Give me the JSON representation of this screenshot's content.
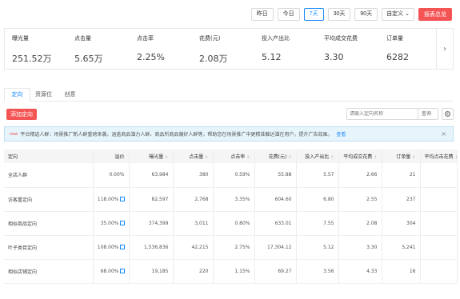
{
  "date_bar": {
    "buttons": [
      "昨日",
      "今日",
      "7天",
      "30天",
      "90天"
    ],
    "active": "7天",
    "custom_label": "自定义",
    "report_label": "报表总览"
  },
  "metrics": [
    {
      "label": "曝光量",
      "value": "251.52万"
    },
    {
      "label": "点击量",
      "value": "5.65万"
    },
    {
      "label": "点击率",
      "value": "2.25%"
    },
    {
      "label": "花费(元)",
      "value": "2.08万"
    },
    {
      "label": "投入产出比",
      "value": "5.12"
    },
    {
      "label": "平均成交花费",
      "value": "3.30"
    },
    {
      "label": "订单量",
      "value": "6282"
    }
  ],
  "tabs": [
    "定向",
    "资源位",
    "创意"
  ],
  "toolbar": {
    "add_label": "添加定向",
    "search_placeholder": "请输入定向名称",
    "search_button": "查询"
  },
  "notice": {
    "badge": "new",
    "text": "平台精选人群：场景推广新人群重磅来袭，涵盖商品潜力人群、商品所商品偏好人群等，帮助您在场景推广中更精准触达潜在用户，提升广告效果。",
    "link": "查看"
  },
  "table": {
    "headers": [
      "定向",
      "溢价",
      "曝光量",
      "点击量",
      "点击率",
      "花费(元)",
      "投入产出比",
      "平均成交花费",
      "订单量",
      "平均点击花费"
    ],
    "rows": [
      [
        "全店人群",
        "0.00%",
        "63,984",
        "380",
        "0.59%",
        "55.88",
        "5.57",
        "2.66",
        "21",
        ""
      ],
      [
        "访客重定向",
        "118.00%",
        "82,597",
        "2,768",
        "3.35%",
        "604.60",
        "6.80",
        "2.55",
        "237",
        ""
      ],
      [
        "相似商品定向",
        "35.00%",
        "374,399",
        "3,011",
        "0.80%",
        "633.01",
        "7.55",
        "2.08",
        "304",
        ""
      ],
      [
        "叶子类目定向",
        "108.00%",
        "1,536,836",
        "42,215",
        "2.75%",
        "17,304.12",
        "5.12",
        "3.30",
        "5,241",
        ""
      ],
      [
        "相似店铺定向",
        "68.00%",
        "19,185",
        "220",
        "1.15%",
        "69.27",
        "3.56",
        "4.33",
        "16",
        ""
      ]
    ],
    "editable_rows": [
      1,
      2,
      3,
      4
    ]
  }
}
